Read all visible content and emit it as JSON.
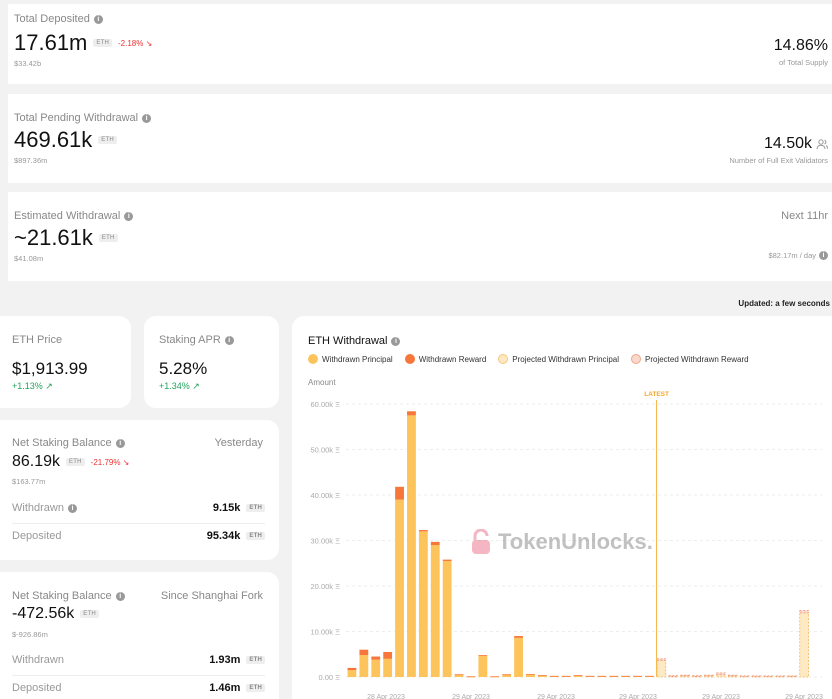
{
  "total_deposited": {
    "label": "Total Deposited",
    "value": "17.61m",
    "unit": "ETH",
    "change": "-2.18% ↘",
    "usd": "$33.42b",
    "pct": "14.86%",
    "pct_label": "of Total Supply"
  },
  "pending_withdrawal": {
    "label": "Total Pending Withdrawal",
    "value": "469.61k",
    "unit": "ETH",
    "usd": "$897.36m",
    "validators": "14.50k",
    "validators_label": "Number of Full Exit Validators"
  },
  "estimated_withdrawal": {
    "label": "Estimated Withdrawal",
    "value": "~21.61k",
    "unit": "ETH",
    "usd": "$41.08m",
    "next": "Next 11hr",
    "rate": "$82.17m / day"
  },
  "updated": "Updated: a few seconds",
  "eth_price": {
    "label": "ETH Price",
    "value": "$1,913.99",
    "change": "+1.13% ↗"
  },
  "staking_apr": {
    "label": "Staking APR",
    "value": "5.28%",
    "change": "+1.34% ↗"
  },
  "net_yesterday": {
    "label": "Net Staking Balance",
    "period": "Yesterday",
    "value": "86.19k",
    "unit": "ETH",
    "change": "-21.79% ↘",
    "usd": "$163.77m",
    "withdrawn_label": "Withdrawn",
    "withdrawn": "9.15k",
    "deposited_label": "Deposited",
    "deposited": "95.34k"
  },
  "net_shanghai": {
    "label": "Net Staking Balance",
    "period": "Since Shanghai Fork",
    "value": "-472.56k",
    "unit": "ETH",
    "usd": "$-926.86m",
    "withdrawn_label": "Withdrawn",
    "withdrawn": "1.93m",
    "deposited_label": "Deposited",
    "deposited": "1.46m"
  },
  "colors": {
    "principal": "#fcc45a",
    "reward": "#f7773a",
    "proj_principal": "#fde9c3",
    "proj_reward": "#fbd8cc",
    "positive": "#22a35a",
    "negative": "#e33333"
  },
  "chart_title": "ETH Withdrawal",
  "watermark": "TokenUnlocks.",
  "chart_data": {
    "type": "bar",
    "title": "ETH Withdrawal",
    "ylabel": "Amount",
    "ylim": [
      0,
      60000
    ],
    "yticks": [
      "0.00 Ξ",
      "10.00k Ξ",
      "20.00k Ξ",
      "30.00k Ξ",
      "40.00k Ξ",
      "50.00k Ξ",
      "60.00k Ξ"
    ],
    "xticks": [
      "28 Apr 2023",
      "29 Apr 2023",
      "29 Apr 2023",
      "29 Apr 2023",
      "29 Apr 2023",
      "29 Apr 2023"
    ],
    "marker_label": "LATEST",
    "marker_index": 26,
    "series": [
      {
        "name": "Withdrawn Principal",
        "values": [
          1500,
          4800,
          3800,
          4000,
          39000,
          57500,
          32000,
          29000,
          25500,
          500,
          100,
          4600,
          100,
          500,
          8600,
          500,
          300,
          200,
          200,
          300,
          200,
          200,
          200,
          200,
          200,
          200,
          0,
          0,
          0,
          0,
          0,
          0,
          0,
          0,
          0,
          0,
          0,
          0,
          0,
          0
        ]
      },
      {
        "name": "Withdrawn Reward",
        "values": [
          500,
          1200,
          700,
          1500,
          2800,
          900,
          300,
          700,
          300,
          100,
          50,
          200,
          50,
          100,
          400,
          150,
          100,
          50,
          50,
          100,
          50,
          50,
          50,
          50,
          50,
          50,
          0,
          0,
          0,
          0,
          0,
          0,
          0,
          0,
          0,
          0,
          0,
          0,
          0,
          0
        ]
      },
      {
        "name": "Projected Withdrawn Principal",
        "values": [
          0,
          0,
          0,
          0,
          0,
          0,
          0,
          0,
          0,
          0,
          0,
          0,
          0,
          0,
          0,
          0,
          0,
          0,
          0,
          0,
          0,
          0,
          0,
          0,
          0,
          0,
          3600,
          200,
          300,
          200,
          300,
          500,
          300,
          200,
          200,
          200,
          200,
          200,
          14100,
          0
        ]
      },
      {
        "name": "Projected Withdrawn Reward",
        "values": [
          0,
          0,
          0,
          0,
          0,
          0,
          0,
          0,
          0,
          0,
          0,
          0,
          0,
          0,
          0,
          0,
          0,
          0,
          0,
          0,
          0,
          0,
          0,
          0,
          0,
          0,
          400,
          100,
          100,
          100,
          100,
          400,
          100,
          50,
          50,
          50,
          50,
          50,
          500,
          0
        ]
      }
    ]
  }
}
